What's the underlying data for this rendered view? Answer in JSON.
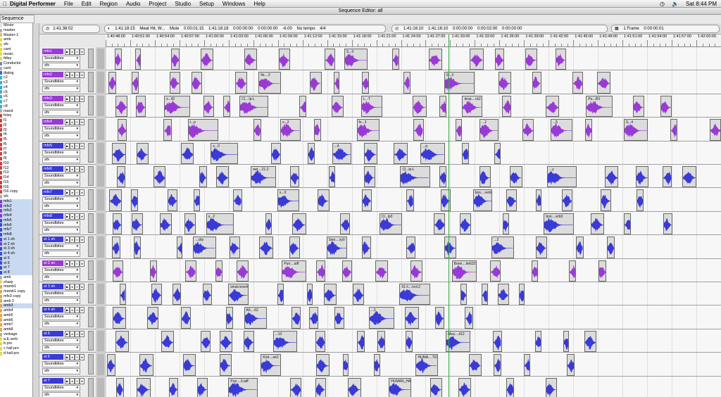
{
  "menubar": {
    "app_name": "Digital Performer",
    "menus": [
      "File",
      "Edit",
      "Region",
      "Audio",
      "Project",
      "Studio",
      "Setup",
      "Windows",
      "Help"
    ],
    "clock": "Sat 8:44 PM",
    "icons": [
      "apple-icon",
      "time-machine-icon",
      "volume-icon"
    ]
  },
  "window": {
    "title": "Sequence Editor: all"
  },
  "editor_tab": "Sequence Editor",
  "tracklist": [
    {
      "label": "Movie",
      "color": "#e0e0e0"
    },
    {
      "label": "master",
      "color": "#b0b0b0"
    },
    {
      "label": "Master-1",
      "color": "#d6c36a"
    },
    {
      "label": "amb",
      "color": "#e6d84a"
    },
    {
      "label": "sfx",
      "color": "#e6d84a"
    },
    {
      "label": "cant",
      "color": "#e6d84a"
    },
    {
      "label": "music",
      "color": "#e6d84a"
    },
    {
      "label": "fdley",
      "color": "#e6d84a"
    },
    {
      "label": "Conductor",
      "color": "#6688cc"
    },
    {
      "label": "cant",
      "color": "#b0b0b0"
    },
    {
      "label": "dialog",
      "color": "#3a5fd0"
    },
    {
      "label": "c2",
      "color": "#3ab0d0"
    },
    {
      "label": "c3",
      "color": "#3ab0d0"
    },
    {
      "label": "c4",
      "color": "#3ab0d0"
    },
    {
      "label": "c5",
      "color": "#3ab0d0"
    },
    {
      "label": "c6",
      "color": "#3ab0d0"
    },
    {
      "label": "c7",
      "color": "#3ab0d0"
    },
    {
      "label": "c8",
      "color": "#3ab0d0"
    },
    {
      "label": "mand",
      "color": "#b0b0b0"
    },
    {
      "label": "foley",
      "color": "#d04040"
    },
    {
      "label": "f1",
      "color": "#d04040"
    },
    {
      "label": "f2",
      "color": "#d04040"
    },
    {
      "label": "f3",
      "color": "#d04040"
    },
    {
      "label": "f4",
      "color": "#d04040"
    },
    {
      "label": "f5",
      "color": "#d04040"
    },
    {
      "label": "f6",
      "color": "#d04040"
    },
    {
      "label": "f7",
      "color": "#d04040"
    },
    {
      "label": "f8",
      "color": "#d04040"
    },
    {
      "label": "f9",
      "color": "#d04040"
    },
    {
      "label": "f10",
      "color": "#d04040"
    },
    {
      "label": "f12",
      "color": "#d04040"
    },
    {
      "label": "f13",
      "color": "#d04040"
    },
    {
      "label": "f14",
      "color": "#d04040"
    },
    {
      "label": "f15",
      "color": "#d04040"
    },
    {
      "label": "f16",
      "color": "#d04040"
    },
    {
      "label": "f16 copy",
      "color": "#d04040"
    },
    {
      "label": "sfx",
      "color": "#b0b0b0"
    },
    {
      "label": "mfx1",
      "color": "#8a3ad0",
      "selected": true
    },
    {
      "label": "mfx2",
      "color": "#8a3ad0",
      "selected": true
    },
    {
      "label": "mfx3",
      "color": "#8a3ad0",
      "selected": true
    },
    {
      "label": "mfx4",
      "color": "#8a3ad0",
      "selected": true
    },
    {
      "label": "mfx5",
      "color": "#3a4ad0",
      "selected": true
    },
    {
      "label": "mfx6",
      "color": "#3a4ad0",
      "selected": true
    },
    {
      "label": "mfx7",
      "color": "#3a4ad0",
      "selected": true
    },
    {
      "label": "mfx8",
      "color": "#3a4ad0",
      "selected": true
    },
    {
      "label": "st 1 sh",
      "color": "#3a4ad0",
      "selected": true
    },
    {
      "label": "st 2 sh",
      "color": "#8a3ad0",
      "selected": true
    },
    {
      "label": "st 3 sh",
      "color": "#3a4ad0",
      "selected": true
    },
    {
      "label": "st 4 sh",
      "color": "#3a4ad0",
      "selected": true
    },
    {
      "label": "st 5",
      "color": "#3a4ad0",
      "selected": true
    },
    {
      "label": "st 6",
      "color": "#3a4ad0",
      "selected": true
    },
    {
      "label": "st 7",
      "color": "#3a4ad0",
      "selected": true
    },
    {
      "label": "st 8",
      "color": "#3a4ad0",
      "selected": true
    },
    {
      "label": "amb",
      "color": "#b0b0b0"
    },
    {
      "label": "sharp",
      "color": "#e6d84a"
    },
    {
      "label": "mamb1",
      "color": "#e6a84a"
    },
    {
      "label": "mamb1 copy",
      "color": "#e6a84a"
    },
    {
      "label": "mfx3 copy",
      "color": "#e6a84a"
    },
    {
      "label": "amb 2",
      "color": "#e6a84a"
    },
    {
      "label": "amb3",
      "color": "#e6a84a",
      "selected": true
    },
    {
      "label": "amb4",
      "color": "#e6a84a"
    },
    {
      "label": "amb5",
      "color": "#e6a84a"
    },
    {
      "label": "amb6",
      "color": "#e6a84a"
    },
    {
      "label": "amb7",
      "color": "#e6a84a"
    },
    {
      "label": "amb8",
      "color": "#e6a84a"
    },
    {
      "label": "verbage",
      "color": "#b0b0b0"
    },
    {
      "label": "a.E.verb",
      "color": "#e6d84a"
    },
    {
      "label": "b pro",
      "color": "#e6d84a"
    },
    {
      "label": "c hall pro",
      "color": "#e6d84a"
    },
    {
      "label": "d hall pro",
      "color": "#e6d84a"
    }
  ],
  "toolbar": {
    "counter": "1:41:38:02",
    "edit_fields": [
      "1:41:18:15",
      "Meat Hit, W...",
      "Mute",
      "0:00:01:15",
      "1:41:18:18",
      "0:00:00:00",
      "0:00:00:00",
      "-6.00",
      "No tempo",
      "4/4"
    ],
    "selection_fields": [
      "1:41:16:10",
      "1:41:16:10",
      "0:00:00:00",
      "0:00:02:00",
      "0:00:00:00"
    ],
    "grid_value": "1 Frame",
    "grid_offset": "0:00:00:01"
  },
  "ruler_labels": [
    "1:40:48:00",
    "1:40:51:00",
    "1:40:54:00",
    "1:40:57:00",
    "1:41:00:00",
    "1:41:03:00",
    "1:41:06:00",
    "1:41:09:00",
    "1:41:12:00",
    "1:41:15:00",
    "1:41:18:00",
    "1:41:21:00",
    "1:41:24:00",
    "1:41:27:00",
    "1:41:30:00",
    "1:41:33:00",
    "1:41:36:00",
    "1:41:39:00",
    "1:41:42:00",
    "1:41:45:00",
    "1:41:48:00",
    "1:41:51:00",
    "1:41:54:00",
    "1:41:57:00",
    "1:42:00:00"
  ],
  "tracks": [
    {
      "name": "mfx1",
      "color": "#9a3ad6",
      "input": "Soundbites",
      "output": "sfx"
    },
    {
      "name": "mfx2",
      "color": "#9a3ad6",
      "input": "Soundbites",
      "output": "sfx"
    },
    {
      "name": "mfx3",
      "color": "#9a3ad6",
      "input": "Soundbites",
      "output": "sfx"
    },
    {
      "name": "mfx4",
      "color": "#9a3ad6",
      "input": "Soundbites",
      "output": "sfx"
    },
    {
      "name": "mfx5",
      "color": "#3a3ad6",
      "input": "Soundbites",
      "output": "sfx"
    },
    {
      "name": "mfx6",
      "color": "#3a3ad6",
      "input": "Soundbites",
      "output": "sfx"
    },
    {
      "name": "mfx7",
      "color": "#3a3ad6",
      "input": "Soundbites",
      "output": "sfx"
    },
    {
      "name": "mfx8",
      "color": "#3a3ad6",
      "input": "Soundbites",
      "output": "sfx"
    },
    {
      "name": "st 1 sh",
      "color": "#3a3ad6",
      "input": "Soundbites",
      "output": "sfx"
    },
    {
      "name": "st 2 sh",
      "color": "#9a3ad6",
      "input": "Soundbites",
      "output": "sfx"
    },
    {
      "name": "st 3 sh",
      "color": "#3a3ad6",
      "input": "Soundbites",
      "output": "sfx"
    },
    {
      "name": "st 4 sh",
      "color": "#3a3ad6",
      "input": "Soundbites",
      "output": "sfx"
    },
    {
      "name": "st 5",
      "color": "#3a3ad6",
      "input": "Soundbites",
      "output": "sfx"
    },
    {
      "name": "st 6",
      "color": "#3a3ad6",
      "input": "Soundbites",
      "output": "sfx"
    },
    {
      "name": "st 7",
      "color": "#3a3ad6",
      "input": "Soundbites",
      "output": "sfx"
    }
  ],
  "clips": [
    [
      "mfx1",
      "S...0"
    ],
    [
      "mfx2",
      "fis....2"
    ],
    [
      "mfx2",
      "S...3"
    ],
    [
      "mfx3",
      "s...42"
    ],
    [
      "mfx3",
      "Cl....lp-L"
    ],
    [
      "mfx3",
      "L...T"
    ],
    [
      "mfx3",
      "drop....ck2"
    ],
    [
      "mfx3",
      "Pu...R3"
    ],
    [
      "mfx4",
      "t...p"
    ],
    [
      "mfx4",
      "s...2"
    ],
    [
      "mfx4",
      "fs...3"
    ],
    [
      "mfx4",
      "...2"
    ],
    [
      "mfx4",
      "...5"
    ],
    [
      "mfx4",
      "S...4"
    ],
    [
      "mfx5",
      "s...0"
    ],
    [
      "mfx5",
      "...4"
    ],
    [
      "mfx5",
      "...q"
    ],
    [
      "mfx6",
      "swi....21.2"
    ],
    [
      "mfx6",
      "Cl...lp-L"
    ],
    [
      "mfx6",
      "...y"
    ],
    [
      "mfx7",
      "s...0"
    ],
    [
      "mfx7",
      "boo....verb2"
    ],
    [
      "mfx8",
      "s...2"
    ],
    [
      "mfx8",
      "Cl...lp3"
    ],
    [
      "mfx8",
      "boo....erb3"
    ],
    [
      "st 1 sh",
      "...clip"
    ],
    [
      "st 1 sh",
      "Swo....xy0"
    ],
    [
      "st 1 sh",
      "...2"
    ],
    [
      "st 2 sh",
      "Pun....aiff"
    ],
    [
      "st 2 sh",
      "Bone....ite632"
    ],
    [
      "st 3 sh",
      "smal.reverb6"
    ],
    [
      "st 3 sh",
      "01 li....hcli.2"
    ],
    [
      "st 4 sh",
      "A5....62"
    ],
    [
      "st 4 sh",
      "...2"
    ],
    [
      "st 5",
      "...10"
    ],
    [
      "st 5",
      "Mea....d12"
    ],
    [
      "st 6",
      "Knit....ek2"
    ],
    [
      "st 6",
      "HUMA....TOGE"
    ],
    [
      "st 7",
      "Pun....3.aiff"
    ],
    [
      "st 7",
      "HUMAN_HA....HANDS_TOGE"
    ]
  ]
}
